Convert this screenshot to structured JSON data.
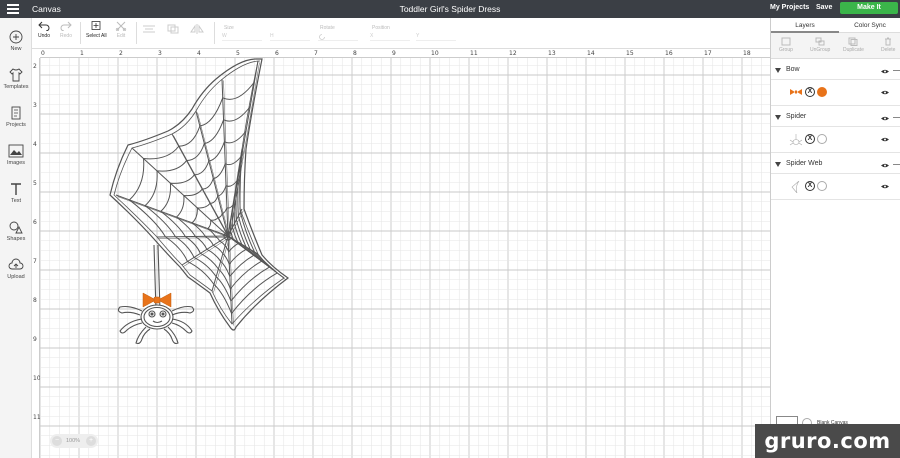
{
  "topbar": {
    "app_title": "Canvas",
    "doc_title": "Toddler Girl's Spider Dress",
    "my_projects": "My Projects",
    "save": "Save",
    "make_it": "Make It"
  },
  "toolbar": {
    "undo": "Undo",
    "redo": "Redo",
    "select_all": "Select All",
    "edit": "Edit",
    "size_label": "Size",
    "size_w": "W",
    "size_h": "H",
    "rotate_label": "Rotate",
    "position_label": "Position",
    "pos_x": "X",
    "pos_y": "Y"
  },
  "sidebar": {
    "items": [
      {
        "label": "New",
        "icon": "plus-circle-icon"
      },
      {
        "label": "Templates",
        "icon": "shirt-icon"
      },
      {
        "label": "Projects",
        "icon": "projects-icon"
      },
      {
        "label": "Images",
        "icon": "image-icon"
      },
      {
        "label": "Text",
        "icon": "text-icon"
      },
      {
        "label": "Shapes",
        "icon": "shapes-icon"
      },
      {
        "label": "Upload",
        "icon": "upload-cloud-icon"
      }
    ]
  },
  "canvas": {
    "ruler_top": [
      "0",
      "1",
      "2",
      "3",
      "4",
      "5",
      "6",
      "7",
      "8",
      "9",
      "10",
      "11",
      "12",
      "13",
      "14",
      "15",
      "16",
      "17",
      "18"
    ],
    "ruler_left": [
      "2",
      "3",
      "4",
      "5",
      "6",
      "7",
      "8",
      "9",
      "10",
      "11"
    ],
    "zoom": "100%"
  },
  "panel": {
    "tab_layers": "Layers",
    "tab_color_sync": "Color Sync",
    "actions": [
      "Group",
      "UnGroup",
      "Duplicate",
      "Delete"
    ],
    "layers": [
      {
        "name": "Bow",
        "color": "#e8731a"
      },
      {
        "name": "Spider",
        "color": "#ffffff"
      },
      {
        "name": "Spider Web",
        "color": "#ffffff"
      }
    ],
    "blank_canvas": "Blank Canvas"
  },
  "watermark": "gruro.com",
  "colors": {
    "accent_green": "#3bb54a",
    "topbar": "#3b3f45",
    "bow_orange": "#e8731a"
  }
}
